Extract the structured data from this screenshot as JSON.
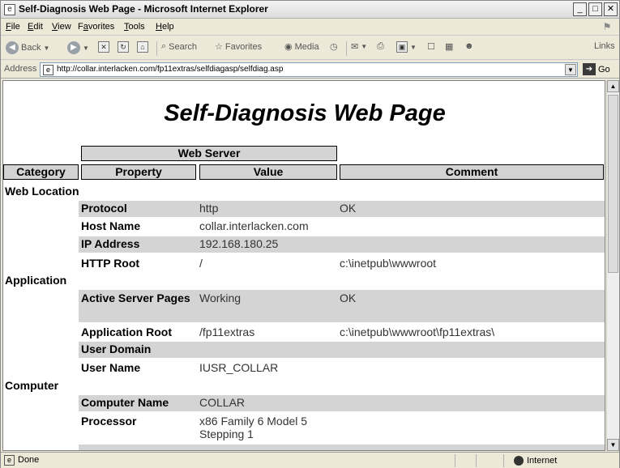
{
  "window": {
    "title": "Self-Diagnosis Web Page - Microsoft Internet Explorer",
    "controls": {
      "minimize": "_",
      "maximize": "□",
      "close": "✕"
    }
  },
  "menubar": {
    "items": [
      {
        "label": "File",
        "accel": "F",
        "rest": "ile"
      },
      {
        "label": "Edit",
        "accel": "E",
        "rest": "dit"
      },
      {
        "label": "View",
        "accel": "V",
        "rest": "iew"
      },
      {
        "label": "Favorites",
        "accel": "a",
        "pre": "F",
        "rest": "vorites"
      },
      {
        "label": "Tools",
        "accel": "T",
        "rest": "ools"
      },
      {
        "label": "Help",
        "accel": "H",
        "rest": "elp"
      }
    ]
  },
  "toolbar": {
    "back": "Back",
    "search": "Search",
    "favorites": "Favorites",
    "media": "Media",
    "links": "Links"
  },
  "addressbar": {
    "label": "Address",
    "url": "http://collar.interlacken.com/fp11extras/selfdiagasp/selfdiag.asp",
    "go": "Go"
  },
  "page": {
    "title": "Self-Diagnosis Web Page",
    "section_header": "Web Server",
    "columns": {
      "category": "Category",
      "property": "Property",
      "value": "Value",
      "comment": "Comment"
    },
    "categories": [
      {
        "name": "Web Location",
        "rows": [
          {
            "property": "Protocol",
            "value": "http",
            "comment": "OK"
          },
          {
            "property": "Host Name",
            "value": "collar.interlacken.com",
            "comment": ""
          },
          {
            "property": "IP Address",
            "value": "192.168.180.25",
            "comment": ""
          },
          {
            "property": "HTTP Root",
            "value": "/",
            "comment": "c:\\inetpub\\wwwroot"
          }
        ]
      },
      {
        "name": "Application",
        "rows": [
          {
            "property": "Active Server Pages",
            "value": "Working",
            "comment": "OK"
          },
          {
            "property": "Application Root",
            "value": "/fp11extras",
            "comment": "c:\\inetpub\\wwwroot\\fp11extras\\"
          },
          {
            "property": "User Domain",
            "value": "",
            "comment": ""
          },
          {
            "property": "User Name",
            "value": "IUSR_COLLAR",
            "comment": ""
          }
        ]
      },
      {
        "name": "Computer",
        "rows": [
          {
            "property": "Computer Name",
            "value": "COLLAR",
            "comment": ""
          },
          {
            "property": "Processor",
            "value": "x86 Family 6 Model 5 Stepping 1",
            "comment": ""
          }
        ]
      }
    ]
  },
  "statusbar": {
    "text": "Done",
    "zone": "Internet"
  },
  "colors": {
    "row_shade": "#d4d4d4",
    "header_fill": "#d4d4d4"
  }
}
